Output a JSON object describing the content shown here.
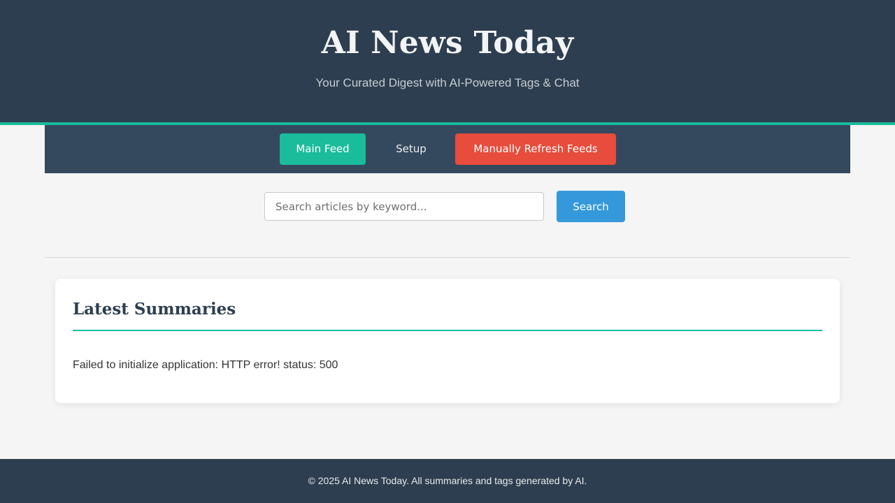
{
  "header": {
    "title": "AI News Today",
    "subtitle": "Your Curated Digest with AI-Powered Tags & Chat"
  },
  "nav": {
    "main_feed_label": "Main Feed",
    "setup_label": "Setup",
    "refresh_label": "Manually Refresh Feeds"
  },
  "search": {
    "placeholder": "Search articles by keyword...",
    "value": "",
    "button_label": "Search"
  },
  "summaries": {
    "title": "Latest Summaries",
    "error_message": "Failed to initialize application: HTTP error! status: 500"
  },
  "footer": {
    "text": "© 2025 AI News Today. All summaries and tags generated by AI."
  },
  "colors": {
    "header_bg": "#2d3e50",
    "nav_bg": "#34495e",
    "accent": "#1abc9c",
    "danger": "#e74c3c",
    "primary": "#3498db",
    "page_bg": "#f4f5f4"
  }
}
